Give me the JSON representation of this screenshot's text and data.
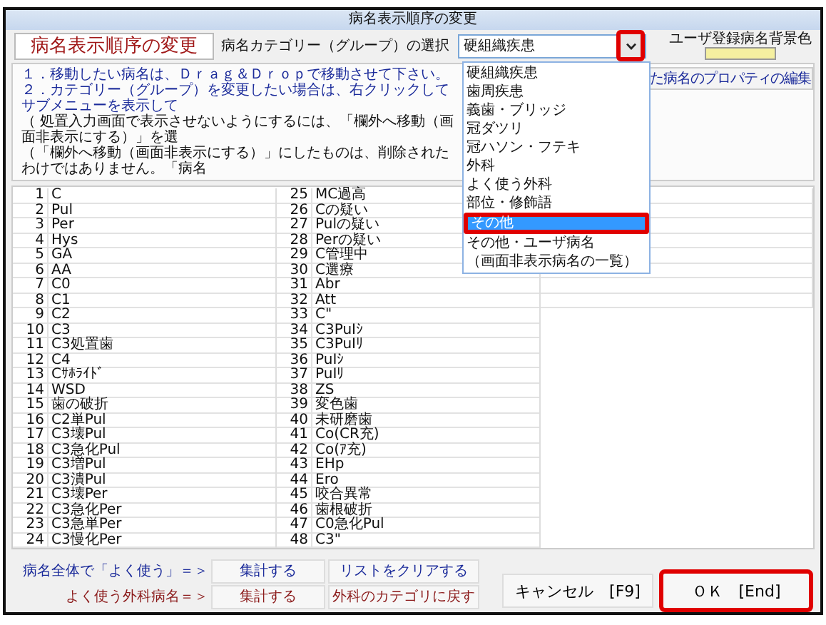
{
  "window": {
    "title": "病名表示順序の変更"
  },
  "header": {
    "heading": "病名表示順序の変更",
    "category_label": "病名カテゴリー（グループ）の選択",
    "category_value": "硬組織疾患",
    "dropdown_button_highlighted": true,
    "user_color_label": "ユーザ登録病名背景色"
  },
  "instructions": [
    {
      "text": "１．移動したい病名は、Ｄｒａｇ＆Ｄｒｏｐで移動させて下さい。",
      "kind": "main"
    },
    {
      "text": "２．カテゴリー（グループ）を変更したい場合は、右クリックしてサブメニューを表示して",
      "kind": "main"
    },
    {
      "text": "（ 処置入力画面で表示させないようにするには、「欄外へ移動（画面非表示にする）」を選",
      "kind": "note"
    },
    {
      "text": "（「欄外へ移動（画面非表示にする）」にしたものは、削除されたわけではありません。「病名",
      "kind": "note"
    }
  ],
  "property_button": "た病名のプロパティの編集",
  "list": {
    "column_1": [
      {
        "no": "1",
        "name": "C"
      },
      {
        "no": "2",
        "name": "Pul"
      },
      {
        "no": "3",
        "name": "Per"
      },
      {
        "no": "4",
        "name": "Hys"
      },
      {
        "no": "5",
        "name": "GA"
      },
      {
        "no": "6",
        "name": "AA"
      },
      {
        "no": "7",
        "name": "C0"
      },
      {
        "no": "8",
        "name": "C1"
      },
      {
        "no": "9",
        "name": "C2"
      },
      {
        "no": "10",
        "name": "C3"
      },
      {
        "no": "11",
        "name": "C3処置歯"
      },
      {
        "no": "12",
        "name": "C4"
      },
      {
        "no": "13",
        "name": "Cｻﾎﾗｲﾄﾞ"
      },
      {
        "no": "14",
        "name": "WSD"
      },
      {
        "no": "15",
        "name": "歯の破折"
      },
      {
        "no": "16",
        "name": "C2単Pul"
      },
      {
        "no": "17",
        "name": "C3壊Pul"
      },
      {
        "no": "18",
        "name": "C3急化Pul"
      },
      {
        "no": "19",
        "name": "C3増Pul"
      },
      {
        "no": "20",
        "name": "C3潰Pul"
      },
      {
        "no": "21",
        "name": "C3壊Per"
      },
      {
        "no": "22",
        "name": "C3急化Per"
      },
      {
        "no": "23",
        "name": "C3急単Per"
      },
      {
        "no": "24",
        "name": "C3慢化Per"
      }
    ],
    "column_2": [
      {
        "no": "25",
        "name": "MC過高"
      },
      {
        "no": "26",
        "name": "Cの疑い"
      },
      {
        "no": "27",
        "name": "Pulの疑い"
      },
      {
        "no": "28",
        "name": "Perの疑い"
      },
      {
        "no": "29",
        "name": "C管理中"
      },
      {
        "no": "30",
        "name": "C選療"
      },
      {
        "no": "31",
        "name": "Abr"
      },
      {
        "no": "32",
        "name": "Att"
      },
      {
        "no": "33",
        "name": "C\""
      },
      {
        "no": "34",
        "name": "C3PuIｼ"
      },
      {
        "no": "35",
        "name": "C3PuIﾘ"
      },
      {
        "no": "36",
        "name": "PuIｼ"
      },
      {
        "no": "37",
        "name": "PuIﾘ"
      },
      {
        "no": "38",
        "name": "ZS"
      },
      {
        "no": "39",
        "name": "変色歯"
      },
      {
        "no": "40",
        "name": "未研磨歯"
      },
      {
        "no": "41",
        "name": "Co(CR充)"
      },
      {
        "no": "42",
        "name": "Co(ｱ充)"
      },
      {
        "no": "43",
        "name": "EHp"
      },
      {
        "no": "44",
        "name": "Ero"
      },
      {
        "no": "45",
        "name": "咬合異常"
      },
      {
        "no": "46",
        "name": "歯根破折"
      },
      {
        "no": "47",
        "name": "C0急化Pul"
      },
      {
        "no": "48",
        "name": "C3\""
      }
    ]
  },
  "dropdown": {
    "items": [
      {
        "label": "硬組織疾患",
        "selected": false,
        "highlighted": false
      },
      {
        "label": "歯周疾患",
        "selected": false,
        "highlighted": false
      },
      {
        "label": "義歯・ブリッジ",
        "selected": false,
        "highlighted": false
      },
      {
        "label": "冠ダツリ",
        "selected": false,
        "highlighted": false
      },
      {
        "label": "冠ハソン・フテキ",
        "selected": false,
        "highlighted": false
      },
      {
        "label": "外科",
        "selected": false,
        "highlighted": false
      },
      {
        "label": "よく使う外科",
        "selected": false,
        "highlighted": false
      },
      {
        "label": "部位・修飾語",
        "selected": false,
        "highlighted": false
      },
      {
        "label": "その他",
        "selected": true,
        "highlighted": true
      },
      {
        "label": "その他・ユーザ病名",
        "selected": false,
        "highlighted": false
      },
      {
        "label": "（画面非表示病名の一覧）",
        "selected": false,
        "highlighted": false
      }
    ]
  },
  "bottom": {
    "rows": [
      {
        "label": "病名全体で「よく使う」＝＞",
        "color": "#1a2a9a",
        "buttons": [
          "集計する",
          "リストをクリアする"
        ]
      },
      {
        "label": "よく使う外科病名＝＞",
        "color": "#8b1a1a",
        "buttons": [
          "集計する",
          "外科のカテゴリに戻す"
        ]
      }
    ],
    "cancel": "キャンセル　[F9]",
    "ok": {
      "label": "ＯＫ　[End]",
      "highlighted": true
    }
  }
}
